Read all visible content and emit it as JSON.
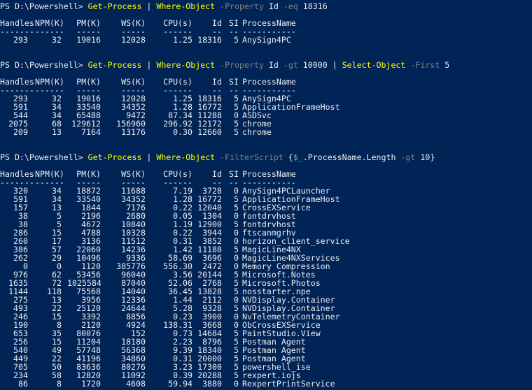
{
  "colors": {
    "background": "#012456",
    "text": "#eeedf0",
    "command": "#ffff00",
    "parameter": "#808080",
    "variable": "#3fd47f"
  },
  "prompt": "PS D:\\Powershell>",
  "headers": {
    "handles": "Handles",
    "npm": "NPM(K)",
    "pm": "PM(K)",
    "ws": "WS(K)",
    "cpu": "CPU(s)",
    "id": "Id",
    "si": "SI",
    "name": "ProcessName"
  },
  "underlines": {
    "handles": "-------",
    "npm": "------",
    "pm": "-----",
    "ws": "-----",
    "cpu": "------",
    "id": "--",
    "si": "--",
    "name": "-----------"
  },
  "blocks": [
    {
      "command": [
        {
          "t": "cmd",
          "v": "Get-Process"
        },
        {
          "t": "plain",
          "v": " | "
        },
        {
          "t": "cmd",
          "v": "Where-Object"
        },
        {
          "t": "plain",
          "v": " "
        },
        {
          "t": "param",
          "v": "-Property"
        },
        {
          "t": "plain",
          "v": " Id "
        },
        {
          "t": "param",
          "v": "-eq"
        },
        {
          "t": "plain",
          "v": " 18316"
        }
      ],
      "rows": [
        [
          "293",
          "32",
          "19016",
          "12028",
          "1.25",
          "18316",
          "5",
          "AnySign4PC"
        ]
      ]
    },
    {
      "command": [
        {
          "t": "cmd",
          "v": "Get-Process"
        },
        {
          "t": "plain",
          "v": " | "
        },
        {
          "t": "cmd",
          "v": "Where-Object"
        },
        {
          "t": "plain",
          "v": " "
        },
        {
          "t": "param",
          "v": "-Property"
        },
        {
          "t": "plain",
          "v": " Id "
        },
        {
          "t": "param",
          "v": "-gt"
        },
        {
          "t": "plain",
          "v": " 10000 | "
        },
        {
          "t": "cmd",
          "v": "Select-Object"
        },
        {
          "t": "plain",
          "v": " "
        },
        {
          "t": "param",
          "v": "-First"
        },
        {
          "t": "plain",
          "v": " 5"
        }
      ],
      "rows": [
        [
          "293",
          "32",
          "19016",
          "12028",
          "1.25",
          "18316",
          "5",
          "AnySign4PC"
        ],
        [
          "591",
          "34",
          "33540",
          "34352",
          "1.28",
          "16772",
          "5",
          "ApplicationFrameHost"
        ],
        [
          "544",
          "34",
          "65488",
          "9472",
          "87.34",
          "11288",
          "0",
          "ASDSvc"
        ],
        [
          "2075",
          "68",
          "129612",
          "156960",
          "296.92",
          "12172",
          "5",
          "chrome"
        ],
        [
          "209",
          "13",
          "7164",
          "13176",
          "0.30",
          "12660",
          "5",
          "chrome"
        ]
      ]
    },
    {
      "command": [
        {
          "t": "cmd",
          "v": "Get-Process"
        },
        {
          "t": "plain",
          "v": " | "
        },
        {
          "t": "cmd",
          "v": "Where-Object"
        },
        {
          "t": "plain",
          "v": " "
        },
        {
          "t": "param",
          "v": "-FilterScript"
        },
        {
          "t": "plain",
          "v": " {"
        },
        {
          "t": "var",
          "v": "$_"
        },
        {
          "t": "plain",
          "v": ".ProcessName.Length "
        },
        {
          "t": "param",
          "v": "-gt"
        },
        {
          "t": "plain",
          "v": " 10}"
        }
      ],
      "rows": [
        [
          "320",
          "34",
          "18872",
          "11688",
          "7.19",
          "3728",
          "0",
          "AnySign4PCLauncher"
        ],
        [
          "591",
          "34",
          "33540",
          "34352",
          "1.28",
          "16772",
          "5",
          "ApplicationFrameHost"
        ],
        [
          "157",
          "13",
          "1844",
          "7176",
          "0.22",
          "12040",
          "5",
          "CrossEXService"
        ],
        [
          "38",
          "5",
          "2196",
          "2680",
          "0.05",
          "1304",
          "0",
          "fontdrvhost"
        ],
        [
          "38",
          "5",
          "4672",
          "10840",
          "1.19",
          "12900",
          "5",
          "fontdrvhost"
        ],
        [
          "286",
          "15",
          "4788",
          "10328",
          "0.22",
          "3944",
          "0",
          "ftscanmgrhv"
        ],
        [
          "260",
          "17",
          "3136",
          "11512",
          "0.31",
          "3852",
          "0",
          "horizon_client_service"
        ],
        [
          "386",
          "57",
          "22060",
          "14236",
          "1.42",
          "11188",
          "5",
          "MagicLine4NX"
        ],
        [
          "262",
          "29",
          "10496",
          "9336",
          "58.69",
          "3696",
          "0",
          "MagicLine4NXServices"
        ],
        [
          "0",
          "0",
          "1120",
          "385776",
          "556.30",
          "2472",
          "0",
          "Memory Compression"
        ],
        [
          "976",
          "62",
          "53456",
          "96040",
          "3.56",
          "20144",
          "5",
          "Microsoft.Notes"
        ],
        [
          "1635",
          "72",
          "1025584",
          "87040",
          "52.06",
          "2768",
          "5",
          "Microsoft.Photos"
        ],
        [
          "1144",
          "118",
          "75568",
          "14040",
          "36.45",
          "13828",
          "5",
          "nosstarter.npe"
        ],
        [
          "275",
          "13",
          "3956",
          "12336",
          "1.44",
          "2112",
          "0",
          "NVDisplay.Container"
        ],
        [
          "493",
          "22",
          "25120",
          "24644",
          "5.28",
          "9328",
          "5",
          "NVDisplay.Container"
        ],
        [
          "246",
          "15",
          "3392",
          "8856",
          "0.23",
          "3900",
          "0",
          "NvTelemetryContainer"
        ],
        [
          "190",
          "8",
          "2120",
          "4924",
          "138.31",
          "3668",
          "0",
          "ObCrossEXService"
        ],
        [
          "653",
          "35",
          "80076",
          "152",
          "0.73",
          "14684",
          "5",
          "PaintStudio.View"
        ],
        [
          "256",
          "15",
          "11204",
          "18180",
          "2.23",
          "8796",
          "5",
          "Postman Agent"
        ],
        [
          "540",
          "49",
          "57748",
          "56368",
          "9.39",
          "18340",
          "5",
          "Postman Agent"
        ],
        [
          "449",
          "22",
          "41196",
          "34860",
          "0.31",
          "20000",
          "5",
          "Postman Agent"
        ],
        [
          "705",
          "50",
          "83636",
          "80276",
          "3.23",
          "17300",
          "5",
          "powershell_ise"
        ],
        [
          "234",
          "58",
          "12820",
          "11092",
          "0.39",
          "20288",
          "5",
          "rexpert.iojs"
        ],
        [
          "86",
          "8",
          "1720",
          "4608",
          "59.94",
          "3880",
          "0",
          "RexpertPrintService"
        ]
      ]
    }
  ]
}
